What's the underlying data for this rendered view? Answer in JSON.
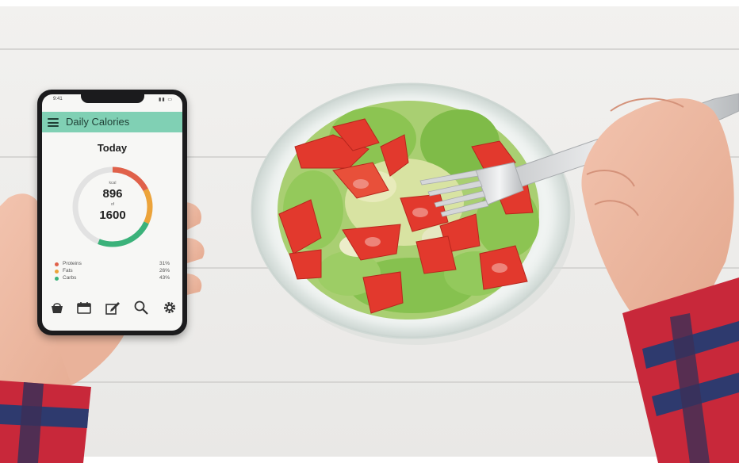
{
  "app": {
    "status_time": "9:41",
    "status_icons": "▮▮ ▭",
    "title": "Daily Calories",
    "today_label": "Today",
    "kcal_unit": "kcal",
    "kcal_value": "896",
    "kcal_of": "of",
    "kcal_goal": "1600",
    "macros": [
      {
        "name": "Proteins",
        "percent": "31%",
        "color": "#e0614a"
      },
      {
        "name": "Fats",
        "percent": "26%",
        "color": "#eca33a"
      },
      {
        "name": "Carbs",
        "percent": "43%",
        "color": "#3bb27a"
      }
    ],
    "nav_icons": [
      "food-basket-icon",
      "calendar-icon",
      "edit-icon",
      "search-icon",
      "settings-icon"
    ]
  },
  "colors": {
    "header": "#80d0b4",
    "ring_track": "#e2e2e2",
    "proteins": "#e0614a",
    "fats": "#eca33a",
    "carbs": "#3bb27a"
  }
}
